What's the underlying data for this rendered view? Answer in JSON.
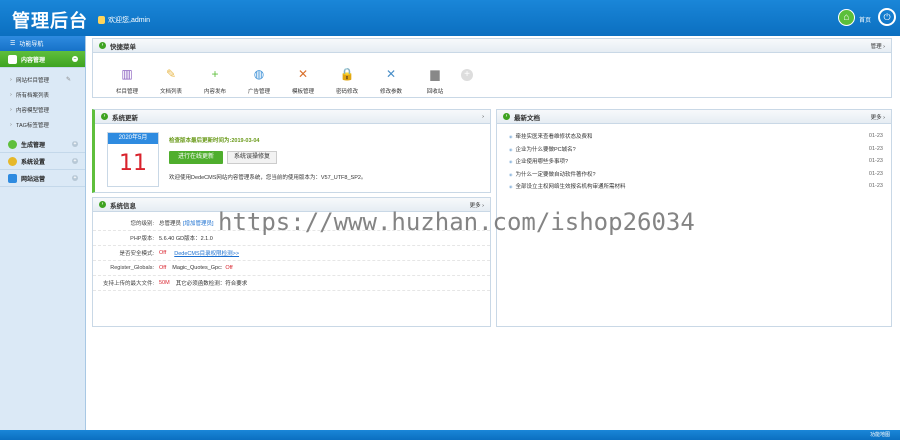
{
  "header": {
    "logo": "管理后台",
    "welcome": "欢迎您,admin",
    "home_label": "首页",
    "power_icon": "power-icon"
  },
  "sidebar": {
    "title": "功能导航",
    "groups": [
      {
        "label": "内容管理",
        "active": true,
        "items": [
          "网站栏目管理",
          "所有档案列表",
          "内容模型管理",
          "TAG标签管理"
        ]
      },
      {
        "label": "生成管理",
        "active": false
      },
      {
        "label": "系统设置",
        "active": false
      },
      {
        "label": "网站运营",
        "active": false
      }
    ]
  },
  "shortcuts": {
    "title": "快捷菜单",
    "manage": "管理 ›",
    "items": [
      {
        "label": "栏目管理",
        "icon": "books-icon",
        "color": "#8a5fbf"
      },
      {
        "label": "文档列表",
        "icon": "notepad-icon",
        "color": "#e8b84a"
      },
      {
        "label": "内容发布",
        "icon": "add-icon",
        "color": "#5fbf3c"
      },
      {
        "label": "广告管理",
        "icon": "globe-icon",
        "color": "#3a8fd6"
      },
      {
        "label": "模板管理",
        "icon": "tools-icon",
        "color": "#d9712d"
      },
      {
        "label": "密码修改",
        "icon": "lock-icon",
        "color": "#e6b82a"
      },
      {
        "label": "修改参数",
        "icon": "wrench-icon",
        "color": "#4a8fc8"
      },
      {
        "label": "回收站",
        "icon": "trash-icon",
        "color": "#888888"
      }
    ]
  },
  "update": {
    "title": "系统更新",
    "cal_month": "2020年5月",
    "cal_day": "11",
    "latest_prefix": "检查版本最后更新时间为:",
    "latest_date": "2019-03-04",
    "btn_online": "进行在线更新",
    "btn_repair": "系统误操修复",
    "note": "欢迎使用DedeCMS网站内容管理系统，您当前的使用版本为：V57_UTF8_SP2。"
  },
  "sysinfo": {
    "title": "系统信息",
    "more": "更多 ›",
    "rows": [
      {
        "k": "您的级别:",
        "v": "总管理员",
        "link": "[增加管理员]"
      },
      {
        "k": "PHP版本:",
        "v": "5.6.40   GD版本：2.1.0"
      },
      {
        "k": "是否安全模式:",
        "v_red": "Off",
        "link": "DedeCMS目录权限检测>>"
      },
      {
        "k": "Register_Globals:",
        "v_red": "Off",
        "v2": "Magic_Quotes_Gpc:",
        "v2_red": "Off"
      },
      {
        "k": "支持上传的最大文件:",
        "v_red": "50M",
        "v2": "其它必须函数检测：符合要求"
      }
    ]
  },
  "news": {
    "title": "最新文档",
    "more": "更多 ›",
    "items": [
      {
        "t": "牵挂实医来查看维修状态及费和",
        "d": "01-23"
      },
      {
        "t": "企业为什么要做PC城名?",
        "d": "01-23"
      },
      {
        "t": "企业使用哪些多事项?",
        "d": "01-23"
      },
      {
        "t": "为什么一定要做自动软件著作权?",
        "d": "01-23"
      },
      {
        "t": "全部设立主权网络生效报名机构审通所需材料",
        "d": "01-23"
      }
    ]
  },
  "footer": {
    "label": "功能地图"
  },
  "watermark": "https://www.huzhan.com/ishop26034"
}
